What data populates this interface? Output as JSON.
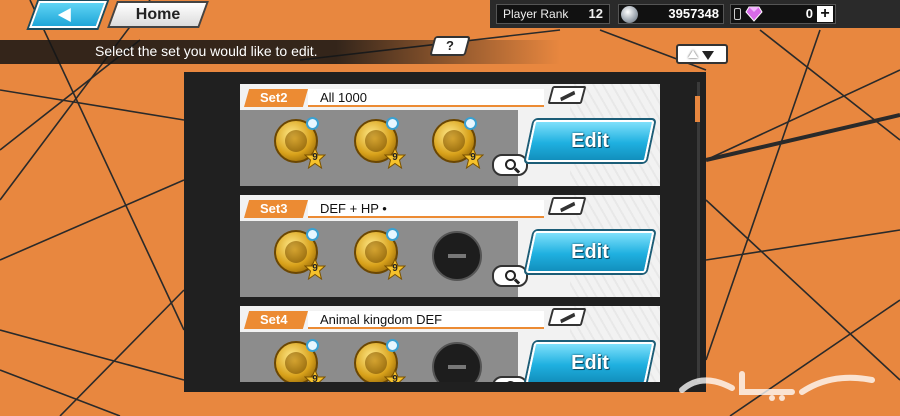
{
  "header": {
    "home_label": "Home",
    "player_rank_label": "Player Rank",
    "player_rank_value": "12",
    "coins": "3957348",
    "gems": "0",
    "plus_symbol": "+"
  },
  "instruction": "Select the set you would like to edit.",
  "help_label": "?",
  "sets": [
    {
      "tag": "Set2",
      "name": "All 1000",
      "medals": [
        {
          "type": "medal",
          "stars": "9"
        },
        {
          "type": "medal",
          "stars": "9"
        },
        {
          "type": "medal",
          "stars": "9"
        }
      ],
      "edit_label": "Edit"
    },
    {
      "tag": "Set3",
      "name": "DEF + HP •",
      "medals": [
        {
          "type": "medal",
          "stars": "9"
        },
        {
          "type": "medal",
          "stars": "9"
        },
        {
          "type": "empty"
        }
      ],
      "edit_label": "Edit"
    },
    {
      "tag": "Set4",
      "name": "Animal kingdom DEF",
      "medals": [
        {
          "type": "medal",
          "stars": "9"
        },
        {
          "type": "medal",
          "stars": "9"
        },
        {
          "type": "empty"
        }
      ],
      "edit_label": "Edit"
    }
  ],
  "colors": {
    "background": "#e8873f",
    "set_tag": "#ec8b33",
    "edit_button": "#1fb0e0",
    "panel": "#202020"
  },
  "icons": [
    "back-arrow-icon",
    "coin-icon",
    "gem-icon",
    "plus-icon",
    "help-icon",
    "sort-icon",
    "pencil-icon",
    "magnifier-icon",
    "lock-icon",
    "star-icon"
  ]
}
